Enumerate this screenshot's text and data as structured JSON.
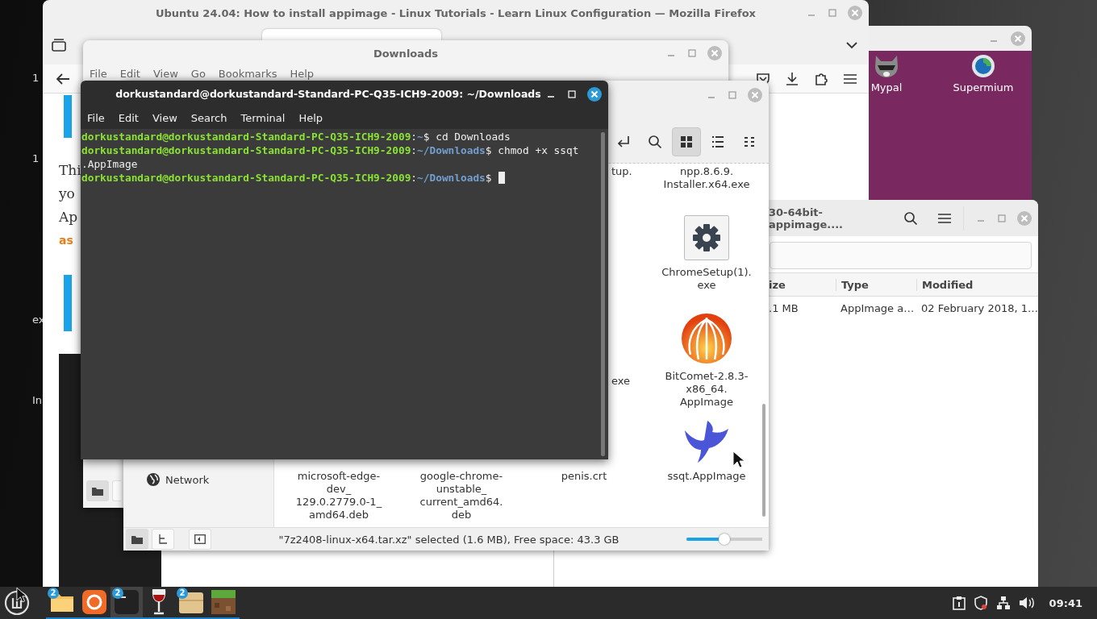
{
  "desktop": {
    "fragments": [
      "1",
      "1",
      "ex",
      "In"
    ]
  },
  "firefox": {
    "title": "Ubuntu 24.04: How to install appimage - Linux Tutorials - Learn Linux Configuration — Mozilla Firefox",
    "article_fragments": [
      {
        "text": "Thi",
        "kind": "plain"
      },
      {
        "text": "yo",
        "kind": "plain"
      },
      {
        "text": "Ap",
        "kind": "plain"
      },
      {
        "text": "as",
        "kind": "accent"
      }
    ]
  },
  "launcher_window": {
    "launchers": [
      {
        "label": "Mypal",
        "kind": "raccoon"
      },
      {
        "label": "Supermium",
        "kind": "globe"
      }
    ]
  },
  "archive_window": {
    "title": "30-64bit-appimage....",
    "columns": [
      "ize",
      "Type",
      "Modified"
    ],
    "row": [
      ".1 MB",
      "AppImage a…",
      "02 February 2018, 1…"
    ]
  },
  "back_file_manager": {
    "title": "Downloads",
    "menu": [
      "File",
      "Edit",
      "View",
      "Go",
      "Bookmarks",
      "Help"
    ]
  },
  "file_manager": {
    "view_modes": [
      {
        "kind": "icons",
        "selected": true
      },
      {
        "kind": "list",
        "selected": false
      },
      {
        "kind": "compact",
        "selected": false
      }
    ],
    "sidebar": [
      {
        "label": "Network"
      }
    ],
    "files": [
      {
        "name": "tup.",
        "kind": "clipped"
      },
      {
        "name": "npp.8.6.9.\nInstaller.x64.exe",
        "kind": "label"
      },
      {
        "name": "ChromeSetup(1).\nexe",
        "kind": "gear"
      },
      {
        "name": "exe",
        "kind": "clipped"
      },
      {
        "name": "BitComet-2.8.3-\nx86_64.\nAppImage",
        "kind": "comet"
      },
      {
        "name": "microsoft-edge-\ndev_\n129.0.2779.0-1_\namd64.deb",
        "kind": "label"
      },
      {
        "name": "google-chrome-\nunstable_\ncurrent_amd64.\ndeb",
        "kind": "label"
      },
      {
        "name": "penis.crt",
        "kind": "label"
      },
      {
        "name": "ssqt.AppImage",
        "kind": "bird"
      }
    ],
    "status": "\"7z2408-linux-x64.tar.xz\" selected (1.6 MB), Free space: 43.3 GB",
    "zoom": {
      "level": 0.5
    }
  },
  "terminal": {
    "title": "dorkustandard@dorkustandard-Standard-PC-Q35-ICH9-2009: ~/Downloads",
    "menu": [
      "File",
      "Edit",
      "View",
      "Search",
      "Terminal",
      "Help"
    ],
    "lines": [
      {
        "cursor": false,
        "segments": [
          {
            "kind": "user",
            "text": "dorkustandard@dorkustandard-Standard-PC-Q35-ICH9-2009"
          },
          {
            "kind": "plain",
            "text": ":"
          },
          {
            "kind": "path",
            "text": "~"
          },
          {
            "kind": "plain",
            "text": "$ cd Downloads"
          }
        ]
      },
      {
        "cursor": false,
        "segments": [
          {
            "kind": "user",
            "text": "dorkustandard@dorkustandard-Standard-PC-Q35-ICH9-2009"
          },
          {
            "kind": "plain",
            "text": ":"
          },
          {
            "kind": "path",
            "text": "~/Downloads"
          },
          {
            "kind": "plain",
            "text": "$ chmod +x ssqt"
          }
        ]
      },
      {
        "cursor": false,
        "segments": [
          {
            "kind": "plain",
            "text": ".AppImage"
          }
        ]
      },
      {
        "cursor": true,
        "segments": [
          {
            "kind": "user",
            "text": "dorkustandard@dorkustandard-Standard-PC-Q35-ICH9-2009"
          },
          {
            "kind": "plain",
            "text": ":"
          },
          {
            "kind": "path",
            "text": "~/Downloads"
          },
          {
            "kind": "plain",
            "text": "$"
          }
        ]
      }
    ]
  },
  "taskbar": {
    "apps": [
      {
        "kind": "folder",
        "badge": "2",
        "active": false
      },
      {
        "kind": "firefox",
        "active": false
      },
      {
        "kind": "terminal",
        "badge": "2",
        "active": true
      },
      {
        "kind": "wine",
        "active": false
      },
      {
        "kind": "archive",
        "badge": "2",
        "active": false
      },
      {
        "kind": "blocks",
        "active": false
      }
    ],
    "clock": "09:41"
  }
}
